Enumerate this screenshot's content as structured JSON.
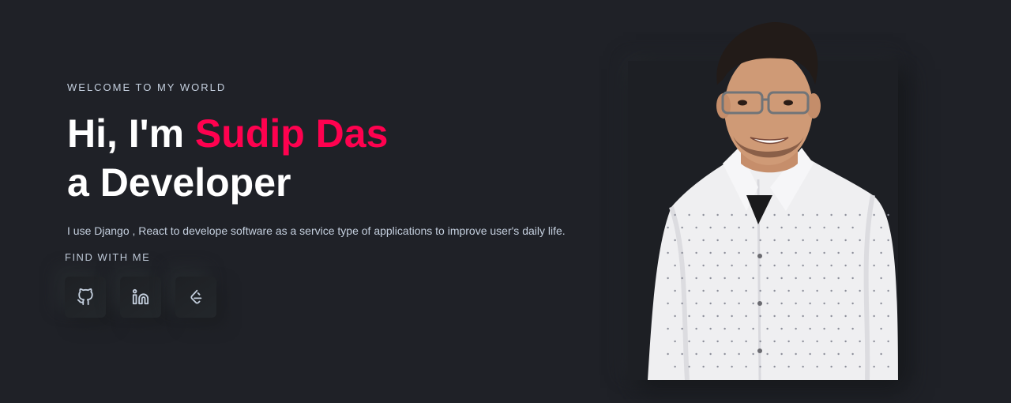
{
  "hero": {
    "eyebrow": "WELCOME TO MY WORLD",
    "greeting": "Hi, I'm ",
    "name": "Sudip Das",
    "role_line": "a Developer",
    "bio": "I use Django , React to develope software as a service type of applications to improve user's daily life.",
    "find_title": "FIND WITH ME"
  },
  "socials": [
    {
      "icon": "github-icon"
    },
    {
      "icon": "linkedin-icon"
    },
    {
      "icon": "leetcode-icon"
    }
  ],
  "colors": {
    "background": "#1f2127",
    "accent": "#ff014f",
    "text_muted": "#c4cfde",
    "heading": "#ffffff"
  }
}
